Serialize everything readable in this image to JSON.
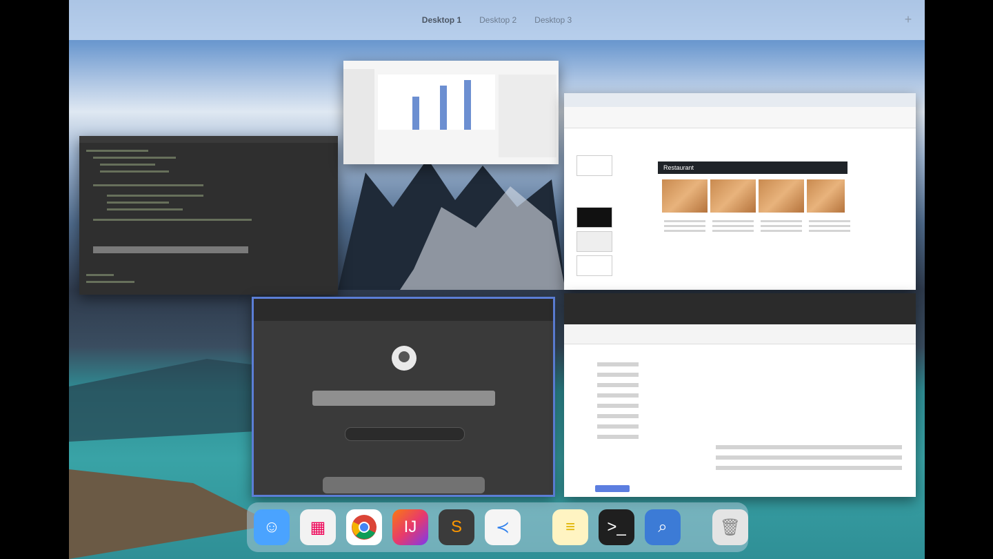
{
  "spaces": {
    "items": [
      {
        "label": "Desktop 1",
        "active": true
      },
      {
        "label": "Desktop 2",
        "active": false
      },
      {
        "label": "Desktop 3",
        "active": false
      }
    ],
    "add_icon": "plus-icon"
  },
  "windows": {
    "browser1_banner": "Restaurant",
    "terminal_theme": "dark",
    "numbers_chart": {
      "type": "bar",
      "values": [
        0.6,
        0.8,
        0.9
      ]
    }
  },
  "dock": {
    "items": [
      {
        "name": "finder",
        "icon": "finder-icon",
        "color": "#4aa3ff"
      },
      {
        "name": "launchpad",
        "icon": "launchpad-icon",
        "color": "#f2f2f2"
      },
      {
        "name": "chrome",
        "icon": "chrome-icon",
        "color": "#ffffff"
      },
      {
        "name": "intellij",
        "icon": "intellij-icon",
        "color": "#e83a6b"
      },
      {
        "name": "sublime",
        "icon": "sublime-icon",
        "color": "#3b3b3b"
      },
      {
        "name": "vscode",
        "icon": "vscode-icon",
        "color": "#f5f5f5"
      },
      {
        "name": "notes",
        "icon": "notes-icon",
        "color": "#fff4c2"
      },
      {
        "name": "terminal",
        "icon": "terminal-icon",
        "color": "#1f1f1f"
      },
      {
        "name": "preview",
        "icon": "preview-icon",
        "color": "#3c7bd6"
      },
      {
        "name": "trash",
        "icon": "trash-icon",
        "color": "#e4e4e4"
      }
    ]
  }
}
